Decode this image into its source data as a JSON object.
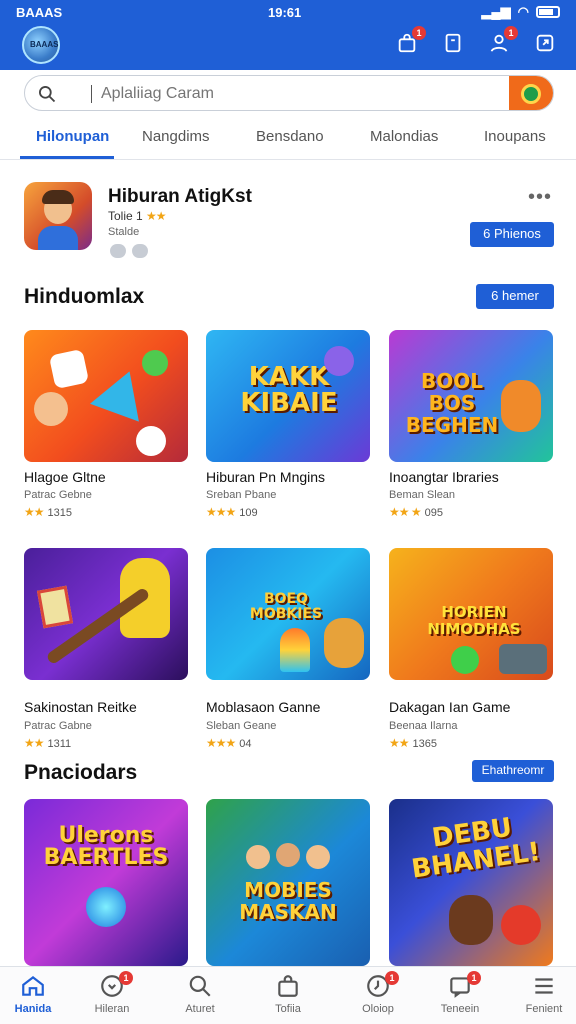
{
  "status": {
    "left": "BAAAS",
    "time": "19:61"
  },
  "header": {
    "logo_text": "BAAAS",
    "icons": [
      "bag-icon",
      "tablet-icon",
      "user-icon",
      "external-icon"
    ],
    "badge": "1"
  },
  "search": {
    "placeholder": "Aplaliiag Caram"
  },
  "tabs": [
    "Hilonupan",
    "Nangdims",
    "Bensdano",
    "Malondias",
    "Inoupans"
  ],
  "featured": {
    "title": "Hiburan AtigKst",
    "rating": "Tolie 1",
    "stars": "★★",
    "subtitle": "Stalde",
    "button": "Phienos",
    "button_icon": "6",
    "more": "•••"
  },
  "section1": {
    "title": "Hinduomlax",
    "button": "6 hemer",
    "cards": [
      {
        "name": "Hlagoe Gltne",
        "sub": "Patrac Gebne",
        "stars": "★★",
        "rating": "1315",
        "art": ""
      },
      {
        "name": "Hiburan Pn Mngins",
        "sub": "Sreban Pbane",
        "stars": "★★★",
        "rating": "109",
        "art": "KAKK KIBAIE"
      },
      {
        "name": "Inoangtar Ibraries",
        "sub": "Beman Slean",
        "stars": "★★ ★",
        "rating": "095",
        "art": "BOOL BOS BEGHEN"
      },
      {
        "name": "Sakinostan Reitke",
        "sub": "Patrac Gabne",
        "stars": "★★",
        "rating": "1311",
        "art": ""
      },
      {
        "name": "Moblasaon Ganne",
        "sub": "Sleban Geane",
        "stars": "★★★",
        "rating": "04",
        "art": "BOEQ MOBKIES"
      },
      {
        "name": "Dakagan Ian Game",
        "sub": "Beenaa Ilarna",
        "stars": "★★",
        "rating": "1365",
        "art": "HORIEN NIMODHAS"
      }
    ]
  },
  "section2": {
    "title": "Pnaciodars",
    "button": "Ehathreomr",
    "cards": [
      {
        "art": "Ulerons BAERTLES"
      },
      {
        "art": "MOBIES MASKAN"
      },
      {
        "art": "DEBU BHANEL!"
      }
    ]
  },
  "nav": [
    {
      "label": "Hanida",
      "icon": "home-icon",
      "badge": ""
    },
    {
      "label": "Hileran",
      "icon": "heart-icon",
      "badge": "1"
    },
    {
      "label": "Aturet",
      "icon": "search-icon",
      "badge": ""
    },
    {
      "label": "Tofiia",
      "icon": "bag-icon",
      "badge": ""
    },
    {
      "label": "Oloiop",
      "icon": "clock-icon",
      "badge": "1"
    },
    {
      "label": "Teneein",
      "icon": "chat-icon",
      "badge": "1"
    },
    {
      "label": "Fenient",
      "icon": "menu-icon",
      "badge": ""
    }
  ],
  "colors": {
    "primary": "#1f5fd6",
    "accent": "#f06a1a",
    "badge": "#e53935",
    "star": "#f2a516"
  }
}
